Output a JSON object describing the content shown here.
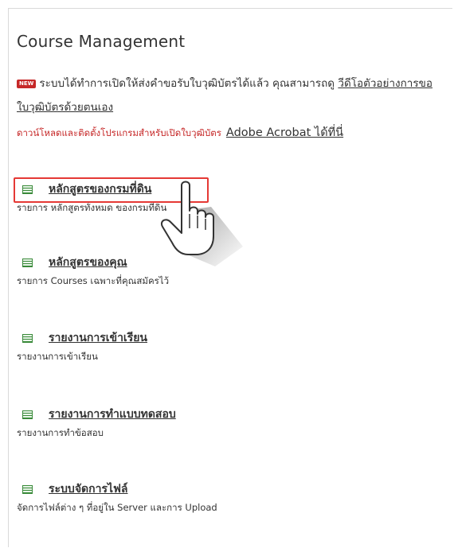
{
  "page": {
    "title": "Course Management"
  },
  "notice": {
    "badge": "NEW",
    "text": "ระบบได้ทำการเปิดให้ส่งคำขอรับใบวุฒิบัตรได้แล้ว คุณสามารถดู ",
    "video_link": "วีดีโอตัวอย่างการขอใบวุฒิบัตรด้วยตนเอง"
  },
  "download": {
    "text": "ดาวน์โหลดและติดตั้งโปรแกรมสำหรับเปิดใบวุฒิบัตร",
    "link": "Adobe Acrobat ได้ที่นี่"
  },
  "items": [
    {
      "label": "หลักสูตรของกรมที่ดิน",
      "description": "รายการ หลักสูตรทั้งหมด ของกรมที่ดิน"
    },
    {
      "label": "หลักสูตรของคุณ",
      "description": "รายการ Courses เฉพาะที่คุณสมัครไว้"
    },
    {
      "label": "รายงานการเข้าเรียน",
      "description": "รายงานการเข้าเรียน"
    },
    {
      "label": "รายงานการทำแบบทดสอบ",
      "description": "รายงานการทำข้อสอบ"
    },
    {
      "label": "ระบบจัดการไฟล์",
      "description": "จัดการไฟล์ต่าง ๆ ที่อยู่ใน Server และการ Upload"
    }
  ],
  "colors": {
    "highlight": "#e53935",
    "icon": "#3a8a3a",
    "warning_text": "#c62828"
  }
}
